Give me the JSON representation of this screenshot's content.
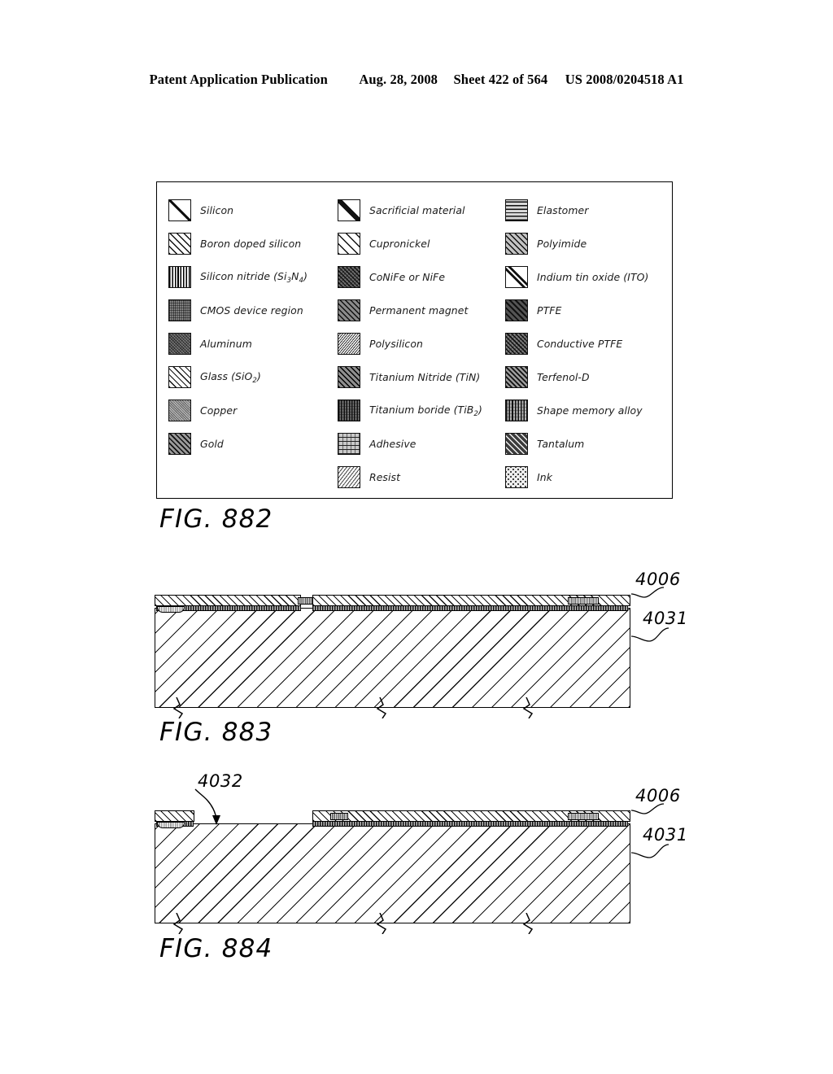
{
  "header": {
    "publication": "Patent Application Publication",
    "date": "Aug. 28, 2008",
    "sheet": "Sheet 422 of 564",
    "patent_number": "US 2008/0204518 A1"
  },
  "legend": {
    "columns": [
      {
        "items": [
          {
            "label": "Silicon",
            "pattern": "p-silicon"
          },
          {
            "label": "Boron doped silicon",
            "pattern": "p-boron"
          },
          {
            "label": "Silicon nitride (Si3N4)",
            "pattern": "p-sinitride",
            "rich": [
              "Silicon nitride (Si",
              "3",
              "N",
              "4",
              ")"
            ]
          },
          {
            "label": "CMOS device region",
            "pattern": "p-cmos"
          },
          {
            "label": "Aluminum",
            "pattern": "p-aluminum"
          },
          {
            "label": "Glass (SiO2)",
            "pattern": "p-glass",
            "rich": [
              "Glass (SiO",
              "2",
              ")"
            ]
          },
          {
            "label": "Copper",
            "pattern": "p-copper"
          },
          {
            "label": "Gold",
            "pattern": "p-gold"
          }
        ]
      },
      {
        "items": [
          {
            "label": "Sacrificial material",
            "pattern": "p-sacrificial"
          },
          {
            "label": "Cupronickel",
            "pattern": "p-cupronickel"
          },
          {
            "label": "CoNiFe or NiFe",
            "pattern": "p-conife"
          },
          {
            "label": "Permanent magnet",
            "pattern": "p-magnet"
          },
          {
            "label": "Polysilicon",
            "pattern": "p-polysilicon"
          },
          {
            "label": "Titanium Nitride (TiN)",
            "pattern": "p-tin"
          },
          {
            "label": "Titanium boride (TiB2)",
            "pattern": "p-tib2",
            "rich": [
              "Titanium boride (TiB",
              "2",
              ")"
            ]
          },
          {
            "label": "Adhesive",
            "pattern": "p-adhesive"
          },
          {
            "label": "Resist",
            "pattern": "p-resist"
          }
        ]
      },
      {
        "items": [
          {
            "label": "Elastomer",
            "pattern": "p-elastomer"
          },
          {
            "label": "Polyimide",
            "pattern": "p-polyimide"
          },
          {
            "label": "Indium tin oxide (ITO)",
            "pattern": "p-ito"
          },
          {
            "label": "PTFE",
            "pattern": "p-ptfe"
          },
          {
            "label": "Conductive PTFE",
            "pattern": "p-cptfe"
          },
          {
            "label": "Terfenol-D",
            "pattern": "p-terfenol"
          },
          {
            "label": "Shape memory alloy",
            "pattern": "p-sma"
          },
          {
            "label": "Tantalum",
            "pattern": "p-tantalum"
          },
          {
            "label": "Ink",
            "pattern": "p-ink"
          }
        ]
      }
    ]
  },
  "figures": {
    "fig882": {
      "caption": "FIG. 882"
    },
    "fig883": {
      "caption": "FIG. 883",
      "refs": [
        {
          "number": "4006"
        },
        {
          "number": "4031"
        }
      ]
    },
    "fig884": {
      "caption": "FIG. 884",
      "refs": [
        {
          "number": "4032"
        },
        {
          "number": "4006"
        },
        {
          "number": "4031"
        }
      ]
    }
  }
}
